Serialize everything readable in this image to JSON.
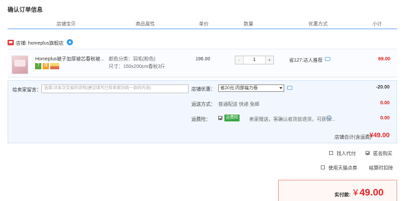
{
  "page_title": "确认订单信息",
  "columns": [
    "店铺宝贝",
    "商品属性",
    "单价",
    "数量",
    "优惠方式",
    "小计"
  ],
  "shop": {
    "label": "店铺: homeplus旗舰店",
    "icon": "shop-icon",
    "chat_icon": "wangwang-chat-icon"
  },
  "item": {
    "name": "Homeplus被子加厚被芯春秋被...",
    "badges": [
      "7",
      "保",
      "卡"
    ],
    "attr_color": "颜色分类：羽毛(粉色)",
    "attr_size": "尺寸：150x200cm春秋3斤",
    "price": "196.00",
    "quantity": "1",
    "minus": "-",
    "plus": "+",
    "promo": "省127:达人推荐",
    "subtotal": "69.00"
  },
  "details": {
    "message_label": "给卖家留言：",
    "message_placeholder": "选填:对本次交易的说明(建议填写已和卖家协商一致的内容)",
    "coupon_label": "店铺优惠：",
    "coupon_selected": "省20元:内部福力卷",
    "coupon_value": "-20.00",
    "shipping_label": "运送方式：",
    "shipping_text": "普通配送 快递 免邮",
    "shipping_value": "0.00",
    "insurance_label": "运费险：",
    "insurance_badge": "运费险",
    "insurance_desc": "卖家赠送，客确认收货前退货，可获保...",
    "insurance_value": "0.00",
    "shop_total_label": "店铺合计(含运费)",
    "shop_total_value": "¥49.00"
  },
  "options": {
    "friend_pay": "找人代付",
    "anonymous": "匿名购买",
    "tmall_points": "使用天猫点券",
    "settle_deduct": "结算时扣除"
  },
  "payment": {
    "label": "实付款:",
    "currency": "¥",
    "amount": "49.00"
  },
  "colors": {
    "accent_red": "#e02020",
    "header_border": "#b2d1ff",
    "detail_bg": "#f2f7ff"
  }
}
